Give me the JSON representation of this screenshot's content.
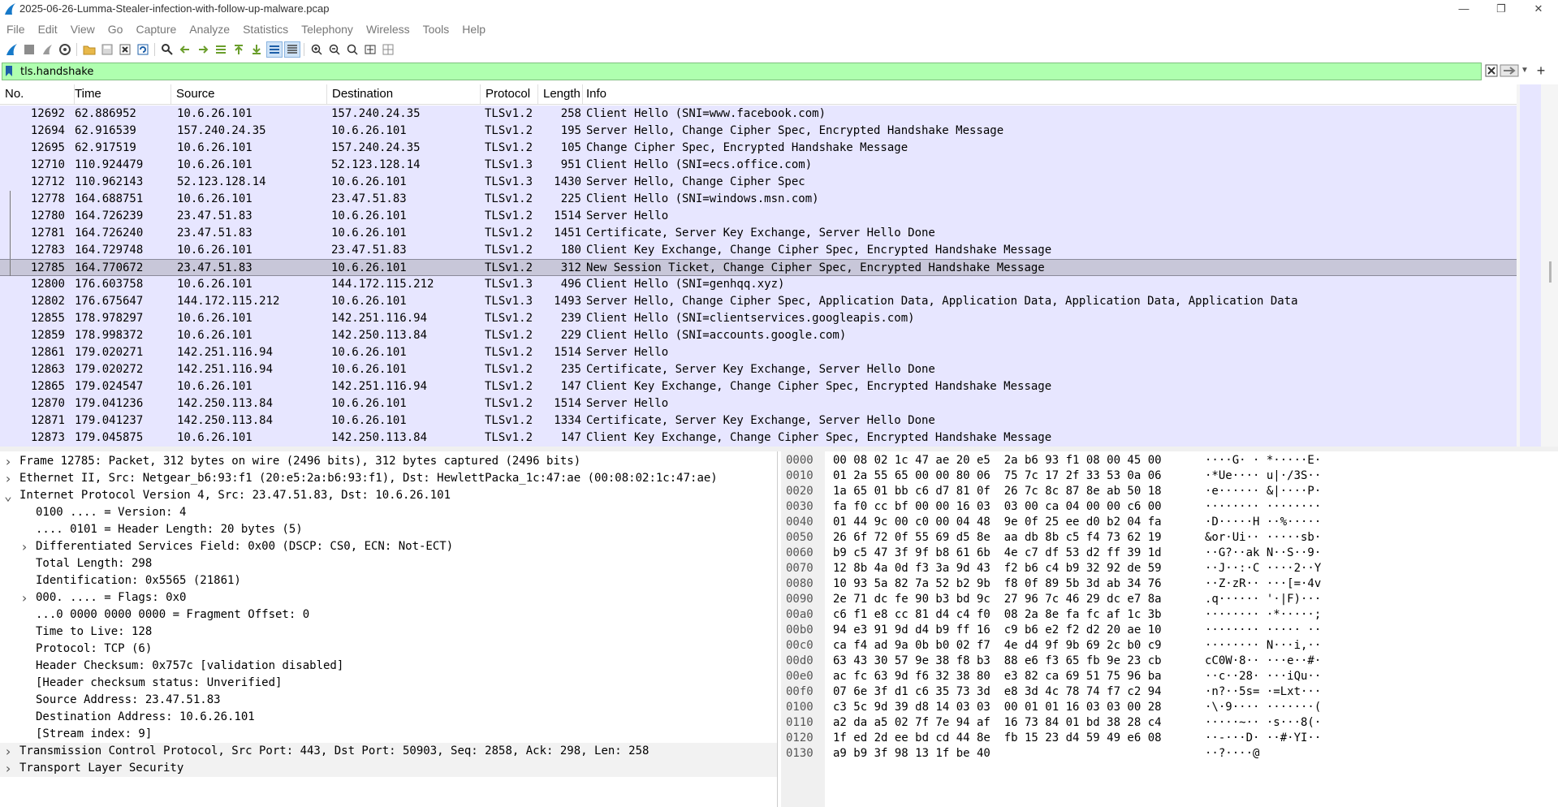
{
  "window": {
    "title": "2025-06-26-Lumma-Stealer-infection-with-follow-up-malware.pcap"
  },
  "menu": [
    "File",
    "Edit",
    "View",
    "Go",
    "Capture",
    "Analyze",
    "Statistics",
    "Telephony",
    "Wireless",
    "Tools",
    "Help"
  ],
  "filter": {
    "value": "tls.handshake"
  },
  "columns": [
    "No.",
    "Time",
    "Source",
    "Destination",
    "Protocol",
    "Length",
    "Info"
  ],
  "packets": [
    {
      "no": "12692",
      "time": "62.886952",
      "src": "10.6.26.101",
      "dst": "157.240.24.35",
      "proto": "TLSv1.2",
      "len": "258",
      "info": "Client Hello (SNI=www.facebook.com)"
    },
    {
      "no": "12694",
      "time": "62.916539",
      "src": "157.240.24.35",
      "dst": "10.6.26.101",
      "proto": "TLSv1.2",
      "len": "195",
      "info": "Server Hello, Change Cipher Spec, Encrypted Handshake Message"
    },
    {
      "no": "12695",
      "time": "62.917519",
      "src": "10.6.26.101",
      "dst": "157.240.24.35",
      "proto": "TLSv1.2",
      "len": "105",
      "info": "Change Cipher Spec, Encrypted Handshake Message"
    },
    {
      "no": "12710",
      "time": "110.924479",
      "src": "10.6.26.101",
      "dst": "52.123.128.14",
      "proto": "TLSv1.3",
      "len": "951",
      "info": "Client Hello (SNI=ecs.office.com)"
    },
    {
      "no": "12712",
      "time": "110.962143",
      "src": "52.123.128.14",
      "dst": "10.6.26.101",
      "proto": "TLSv1.3",
      "len": "1430",
      "info": "Server Hello, Change Cipher Spec"
    },
    {
      "no": "12778",
      "time": "164.688751",
      "src": "10.6.26.101",
      "dst": "23.47.51.83",
      "proto": "TLSv1.2",
      "len": "225",
      "info": "Client Hello (SNI=windows.msn.com)"
    },
    {
      "no": "12780",
      "time": "164.726239",
      "src": "23.47.51.83",
      "dst": "10.6.26.101",
      "proto": "TLSv1.2",
      "len": "1514",
      "info": "Server Hello"
    },
    {
      "no": "12781",
      "time": "164.726240",
      "src": "23.47.51.83",
      "dst": "10.6.26.101",
      "proto": "TLSv1.2",
      "len": "1451",
      "info": "Certificate, Server Key Exchange, Server Hello Done"
    },
    {
      "no": "12783",
      "time": "164.729748",
      "src": "10.6.26.101",
      "dst": "23.47.51.83",
      "proto": "TLSv1.2",
      "len": "180",
      "info": "Client Key Exchange, Change Cipher Spec, Encrypted Handshake Message"
    },
    {
      "no": "12785",
      "time": "164.770672",
      "src": "23.47.51.83",
      "dst": "10.6.26.101",
      "proto": "TLSv1.2",
      "len": "312",
      "info": "New Session Ticket, Change Cipher Spec, Encrypted Handshake Message",
      "selected": true
    },
    {
      "no": "12800",
      "time": "176.603758",
      "src": "10.6.26.101",
      "dst": "144.172.115.212",
      "proto": "TLSv1.3",
      "len": "496",
      "info": "Client Hello (SNI=genhqq.xyz)"
    },
    {
      "no": "12802",
      "time": "176.675647",
      "src": "144.172.115.212",
      "dst": "10.6.26.101",
      "proto": "TLSv1.3",
      "len": "1493",
      "info": "Server Hello, Change Cipher Spec, Application Data, Application Data, Application Data, Application Data"
    },
    {
      "no": "12855",
      "time": "178.978297",
      "src": "10.6.26.101",
      "dst": "142.251.116.94",
      "proto": "TLSv1.2",
      "len": "239",
      "info": "Client Hello (SNI=clientservices.googleapis.com)"
    },
    {
      "no": "12859",
      "time": "178.998372",
      "src": "10.6.26.101",
      "dst": "142.250.113.84",
      "proto": "TLSv1.2",
      "len": "229",
      "info": "Client Hello (SNI=accounts.google.com)"
    },
    {
      "no": "12861",
      "time": "179.020271",
      "src": "142.251.116.94",
      "dst": "10.6.26.101",
      "proto": "TLSv1.2",
      "len": "1514",
      "info": "Server Hello"
    },
    {
      "no": "12863",
      "time": "179.020272",
      "src": "142.251.116.94",
      "dst": "10.6.26.101",
      "proto": "TLSv1.2",
      "len": "235",
      "info": "Certificate, Server Key Exchange, Server Hello Done"
    },
    {
      "no": "12865",
      "time": "179.024547",
      "src": "10.6.26.101",
      "dst": "142.251.116.94",
      "proto": "TLSv1.2",
      "len": "147",
      "info": "Client Key Exchange, Change Cipher Spec, Encrypted Handshake Message"
    },
    {
      "no": "12870",
      "time": "179.041236",
      "src": "142.250.113.84",
      "dst": "10.6.26.101",
      "proto": "TLSv1.2",
      "len": "1514",
      "info": "Server Hello"
    },
    {
      "no": "12871",
      "time": "179.041237",
      "src": "142.250.113.84",
      "dst": "10.6.26.101",
      "proto": "TLSv1.2",
      "len": "1334",
      "info": "Certificate, Server Key Exchange, Server Hello Done"
    },
    {
      "no": "12873",
      "time": "179.045875",
      "src": "10.6.26.101",
      "dst": "142.250.113.84",
      "proto": "TLSv1.2",
      "len": "147",
      "info": "Client Key Exchange, Change Cipher Spec, Encrypted Handshake Message"
    }
  ],
  "details": [
    {
      "depth": 0,
      "arrow": "right",
      "text": "Frame 12785: Packet, 312 bytes on wire (2496 bits), 312 bytes captured (2496 bits)"
    },
    {
      "depth": 0,
      "arrow": "right",
      "text": "Ethernet II, Src: Netgear_b6:93:f1 (20:e5:2a:b6:93:f1), Dst: HewlettPacka_1c:47:ae (00:08:02:1c:47:ae)"
    },
    {
      "depth": 0,
      "arrow": "down",
      "text": "Internet Protocol Version 4, Src: 23.47.51.83, Dst: 10.6.26.101"
    },
    {
      "depth": 1,
      "arrow": "",
      "text": "0100 .... = Version: 4"
    },
    {
      "depth": 1,
      "arrow": "",
      "text": ".... 0101 = Header Length: 20 bytes (5)"
    },
    {
      "depth": 1,
      "arrow": "right",
      "text": "Differentiated Services Field: 0x00 (DSCP: CS0, ECN: Not-ECT)"
    },
    {
      "depth": 1,
      "arrow": "",
      "text": "Total Length: 298"
    },
    {
      "depth": 1,
      "arrow": "",
      "text": "Identification: 0x5565 (21861)"
    },
    {
      "depth": 1,
      "arrow": "right",
      "text": "000. .... = Flags: 0x0"
    },
    {
      "depth": 1,
      "arrow": "",
      "text": "...0 0000 0000 0000 = Fragment Offset: 0"
    },
    {
      "depth": 1,
      "arrow": "",
      "text": "Time to Live: 128"
    },
    {
      "depth": 1,
      "arrow": "",
      "text": "Protocol: TCP (6)"
    },
    {
      "depth": 1,
      "arrow": "",
      "text": "Header Checksum: 0x757c [validation disabled]"
    },
    {
      "depth": 1,
      "arrow": "",
      "text": "[Header checksum status: Unverified]"
    },
    {
      "depth": 1,
      "arrow": "",
      "text": "Source Address: 23.47.51.83"
    },
    {
      "depth": 1,
      "arrow": "",
      "text": "Destination Address: 10.6.26.101"
    },
    {
      "depth": 1,
      "arrow": "",
      "text": "[Stream index: 9]"
    },
    {
      "depth": 0,
      "arrow": "right",
      "text": "Transmission Control Protocol, Src Port: 443, Dst Port: 50903, Seq: 2858, Ack: 298, Len: 258"
    },
    {
      "depth": 0,
      "arrow": "right",
      "text": "Transport Layer Security"
    }
  ],
  "hex": [
    {
      "off": "0000",
      "hex": "00 08 02 1c 47 ae 20 e5  2a b6 93 f1 08 00 45 00",
      "ascii": "····G· · *·····E·"
    },
    {
      "off": "0010",
      "hex": "01 2a 55 65 00 00 80 06  75 7c 17 2f 33 53 0a 06",
      "ascii": "·*Ue···· u|·/3S··"
    },
    {
      "off": "0020",
      "hex": "1a 65 01 bb c6 d7 81 0f  26 7c 8c 87 8e ab 50 18",
      "ascii": "·e······ &|····P·"
    },
    {
      "off": "0030",
      "hex": "fa f0 cc bf 00 00 16 03  03 00 ca 04 00 00 c6 00",
      "ascii": "········ ········"
    },
    {
      "off": "0040",
      "hex": "01 44 9c 00 c0 00 04 48  9e 0f 25 ee d0 b2 04 fa",
      "ascii": "·D·····H ··%·····"
    },
    {
      "off": "0050",
      "hex": "26 6f 72 0f 55 69 d5 8e  aa db 8b c5 f4 73 62 19",
      "ascii": "&or·Ui·· ·····sb·"
    },
    {
      "off": "0060",
      "hex": "b9 c5 47 3f 9f b8 61 6b  4e c7 df 53 d2 ff 39 1d",
      "ascii": "··G?··ak N··S··9·"
    },
    {
      "off": "0070",
      "hex": "12 8b 4a 0d f3 3a 9d 43  f2 b6 c4 b9 32 92 de 59",
      "ascii": "··J··:·C ····2··Y"
    },
    {
      "off": "0080",
      "hex": "10 93 5a 82 7a 52 b2 9b  f8 0f 89 5b 3d ab 34 76",
      "ascii": "··Z·zR·· ···[=·4v"
    },
    {
      "off": "0090",
      "hex": "2e 71 dc fe 90 b3 bd 9c  27 96 7c 46 29 dc e7 8a",
      "ascii": ".q······ '·|F)···"
    },
    {
      "off": "00a0",
      "hex": "c6 f1 e8 cc 81 d4 c4 f0  08 2a 8e fa fc af 1c 3b",
      "ascii": "········ ·*·····;"
    },
    {
      "off": "00b0",
      "hex": "94 e3 91 9d d4 b9 ff 16  c9 b6 e2 f2 d2 20 ae 10",
      "ascii": "········ ····· ··"
    },
    {
      "off": "00c0",
      "hex": "ca f4 ad 9a 0b b0 02 f7  4e d4 9f 9b 69 2c b0 c9",
      "ascii": "········ N···i,··"
    },
    {
      "off": "00d0",
      "hex": "63 43 30 57 9e 38 f8 b3  88 e6 f3 65 fb 9e 23 cb",
      "ascii": "cC0W·8·· ···e··#·"
    },
    {
      "off": "00e0",
      "hex": "ac fc 63 9d f6 32 38 80  e3 82 ca 69 51 75 96 ba",
      "ascii": "··c··28· ···iQu··"
    },
    {
      "off": "00f0",
      "hex": "07 6e 3f d1 c6 35 73 3d  e8 3d 4c 78 74 f7 c2 94",
      "ascii": "·n?··5s= ·=Lxt···"
    },
    {
      "off": "0100",
      "hex": "c3 5c 9d 39 d8 14 03 03  00 01 01 16 03 03 00 28",
      "ascii": "·\\·9···· ·······("
    },
    {
      "off": "0110",
      "hex": "a2 da a5 02 7f 7e 94 af  16 73 84 01 bd 38 28 c4",
      "ascii": "·····~·· ·s···8(·"
    },
    {
      "off": "0120",
      "hex": "1f ed 2d ee bd cd 44 8e  fb 15 23 d4 59 49 e6 08",
      "ascii": "··-···D· ··#·YI··"
    },
    {
      "off": "0130",
      "hex": "a9 b9 3f 98 13 1f be 40",
      "ascii": "··?····@"
    }
  ]
}
